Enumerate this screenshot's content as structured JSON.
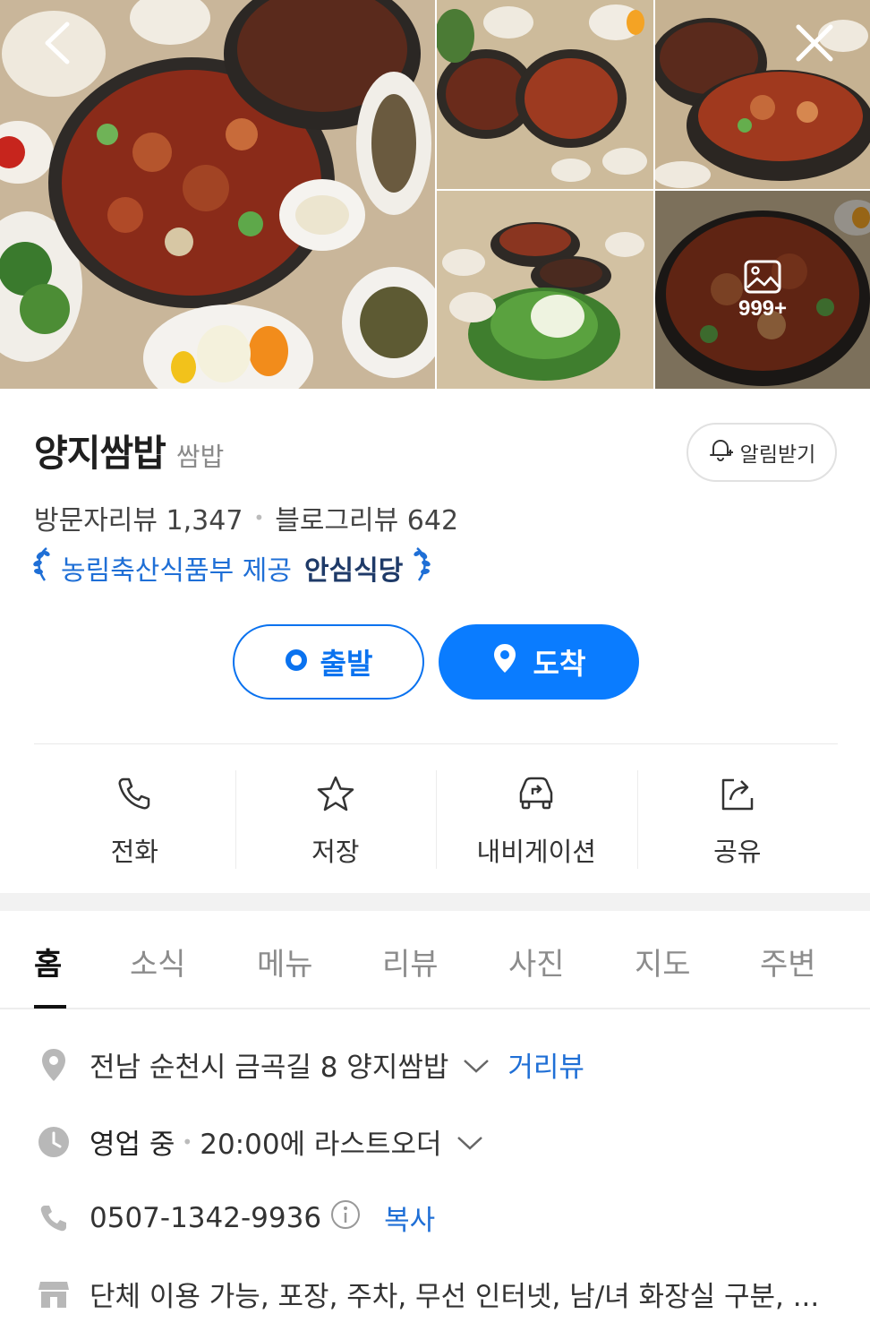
{
  "gallery": {
    "more_count": "999+"
  },
  "header": {
    "name": "양지쌈밥",
    "category": "쌈밥",
    "alarm_label": "알림받기"
  },
  "reviews": {
    "visitor_label": "방문자리뷰",
    "visitor_count": "1,347",
    "blog_label": "블로그리뷰",
    "blog_count": "642"
  },
  "badge": {
    "source": "농림축산식품부 제공",
    "title": "안심식당"
  },
  "route": {
    "depart_label": "출발",
    "arrive_label": "도착"
  },
  "actions": [
    {
      "label": "전화",
      "icon": "phone-icon"
    },
    {
      "label": "저장",
      "icon": "star-icon"
    },
    {
      "label": "내비게이션",
      "icon": "car-icon"
    },
    {
      "label": "공유",
      "icon": "share-icon"
    }
  ],
  "tabs": [
    "홈",
    "소식",
    "메뉴",
    "리뷰",
    "사진",
    "지도",
    "주변"
  ],
  "info": {
    "address": "전남 순천시 금곡길 8 양지쌈밥",
    "street_view": "거리뷰",
    "status": "영업 중",
    "last_order": "20:00에 라스트오더",
    "phone": "0507-1342-9936",
    "copy": "복사",
    "amenities": "단체 이용 가능, 포장, 주차, 무선 인터넷, 남/녀 화장실 구분, ..."
  },
  "colors": {
    "accent": "#0a7cff",
    "link": "#1f6fd6"
  }
}
